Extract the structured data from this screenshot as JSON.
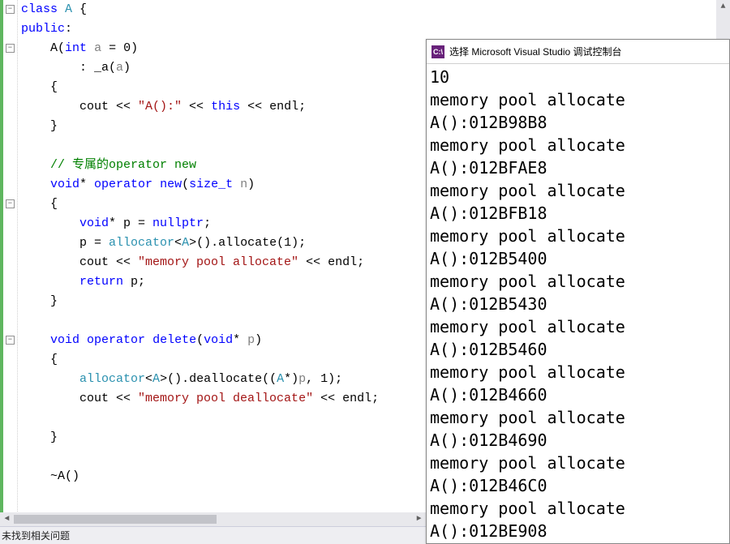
{
  "code": {
    "lines": [
      {
        "indent": 0,
        "tokens": [
          {
            "t": "class ",
            "c": "kw"
          },
          {
            "t": "A",
            "c": "type"
          },
          {
            "t": " {",
            "c": "ident"
          }
        ]
      },
      {
        "indent": 0,
        "tokens": [
          {
            "t": "public",
            "c": "kw"
          },
          {
            "t": ":",
            "c": "ident"
          }
        ]
      },
      {
        "indent": 1,
        "tokens": [
          {
            "t": "A(",
            "c": "ident"
          },
          {
            "t": "int",
            "c": "kw"
          },
          {
            "t": " ",
            "c": "ident"
          },
          {
            "t": "a",
            "c": "gray"
          },
          {
            "t": " = 0)",
            "c": "ident"
          }
        ]
      },
      {
        "indent": 2,
        "tokens": [
          {
            "t": ": _a(",
            "c": "ident"
          },
          {
            "t": "a",
            "c": "gray"
          },
          {
            "t": ")",
            "c": "ident"
          }
        ]
      },
      {
        "indent": 1,
        "tokens": [
          {
            "t": "{",
            "c": "ident"
          }
        ]
      },
      {
        "indent": 2,
        "tokens": [
          {
            "t": "cout << ",
            "c": "ident"
          },
          {
            "t": "\"A():\"",
            "c": "str"
          },
          {
            "t": " << ",
            "c": "ident"
          },
          {
            "t": "this",
            "c": "kw"
          },
          {
            "t": " << endl;",
            "c": "ident"
          }
        ]
      },
      {
        "indent": 1,
        "tokens": [
          {
            "t": "}",
            "c": "ident"
          }
        ]
      },
      {
        "indent": 0,
        "tokens": []
      },
      {
        "indent": 1,
        "tokens": [
          {
            "t": "// 专属的operator new",
            "c": "comment"
          }
        ]
      },
      {
        "indent": 1,
        "tokens": [
          {
            "t": "void",
            "c": "kw"
          },
          {
            "t": "* ",
            "c": "ident"
          },
          {
            "t": "operator",
            "c": "kw"
          },
          {
            "t": " ",
            "c": "ident"
          },
          {
            "t": "new",
            "c": "kw"
          },
          {
            "t": "(",
            "c": "ident"
          },
          {
            "t": "size_t",
            "c": "kw"
          },
          {
            "t": " ",
            "c": "ident"
          },
          {
            "t": "n",
            "c": "gray"
          },
          {
            "t": ")",
            "c": "ident"
          }
        ]
      },
      {
        "indent": 1,
        "tokens": [
          {
            "t": "{",
            "c": "ident"
          }
        ]
      },
      {
        "indent": 2,
        "tokens": [
          {
            "t": "void",
            "c": "kw"
          },
          {
            "t": "* p = ",
            "c": "ident"
          },
          {
            "t": "nullptr",
            "c": "kw"
          },
          {
            "t": ";",
            "c": "ident"
          }
        ]
      },
      {
        "indent": 2,
        "tokens": [
          {
            "t": "p = ",
            "c": "ident"
          },
          {
            "t": "allocator",
            "c": "type"
          },
          {
            "t": "<",
            "c": "ident"
          },
          {
            "t": "A",
            "c": "type"
          },
          {
            "t": ">().allocate(1);",
            "c": "ident"
          }
        ]
      },
      {
        "indent": 2,
        "tokens": [
          {
            "t": "cout << ",
            "c": "ident"
          },
          {
            "t": "\"memory pool allocate\"",
            "c": "str"
          },
          {
            "t": " << endl;",
            "c": "ident"
          }
        ]
      },
      {
        "indent": 2,
        "tokens": [
          {
            "t": "return",
            "c": "kw"
          },
          {
            "t": " p;",
            "c": "ident"
          }
        ]
      },
      {
        "indent": 1,
        "tokens": [
          {
            "t": "}",
            "c": "ident"
          }
        ]
      },
      {
        "indent": 0,
        "tokens": []
      },
      {
        "indent": 1,
        "tokens": [
          {
            "t": "void",
            "c": "kw"
          },
          {
            "t": " ",
            "c": "ident"
          },
          {
            "t": "operator",
            "c": "kw"
          },
          {
            "t": " ",
            "c": "ident"
          },
          {
            "t": "delete",
            "c": "kw"
          },
          {
            "t": "(",
            "c": "ident"
          },
          {
            "t": "void",
            "c": "kw"
          },
          {
            "t": "* ",
            "c": "ident"
          },
          {
            "t": "p",
            "c": "gray"
          },
          {
            "t": ")",
            "c": "ident"
          }
        ]
      },
      {
        "indent": 1,
        "tokens": [
          {
            "t": "{",
            "c": "ident"
          }
        ]
      },
      {
        "indent": 2,
        "tokens": [
          {
            "t": "allocator",
            "c": "type"
          },
          {
            "t": "<",
            "c": "ident"
          },
          {
            "t": "A",
            "c": "type"
          },
          {
            "t": ">().deallocate((",
            "c": "ident"
          },
          {
            "t": "A",
            "c": "type"
          },
          {
            "t": "*)",
            "c": "ident"
          },
          {
            "t": "p",
            "c": "gray"
          },
          {
            "t": ", 1);",
            "c": "ident"
          }
        ]
      },
      {
        "indent": 2,
        "tokens": [
          {
            "t": "cout << ",
            "c": "ident"
          },
          {
            "t": "\"memory pool deallocate\"",
            "c": "str"
          },
          {
            "t": " << endl;",
            "c": "ident"
          }
        ]
      },
      {
        "indent": 0,
        "tokens": []
      },
      {
        "indent": 1,
        "tokens": [
          {
            "t": "}",
            "c": "ident"
          }
        ]
      },
      {
        "indent": 0,
        "tokens": []
      },
      {
        "indent": 1,
        "tokens": [
          {
            "t": "~A()",
            "c": "ident"
          }
        ]
      }
    ],
    "folds": [
      0,
      2,
      10,
      17
    ]
  },
  "status": {
    "text": "未找到相关问题"
  },
  "console": {
    "title_prefix": "选择",
    "title": "Microsoft Visual Studio 调试控制台",
    "lines": [
      "10",
      "memory pool allocate",
      "A():012B98B8",
      "memory pool allocate",
      "A():012BFAE8",
      "memory pool allocate",
      "A():012BFB18",
      "memory pool allocate",
      "A():012B5400",
      "memory pool allocate",
      "A():012B5430",
      "memory pool allocate",
      "A():012B5460",
      "memory pool allocate",
      "A():012B4660",
      "memory pool allocate",
      "A():012B4690",
      "memory pool allocate",
      "A():012B46C0",
      "memory pool allocate",
      "A():012BE908"
    ]
  }
}
